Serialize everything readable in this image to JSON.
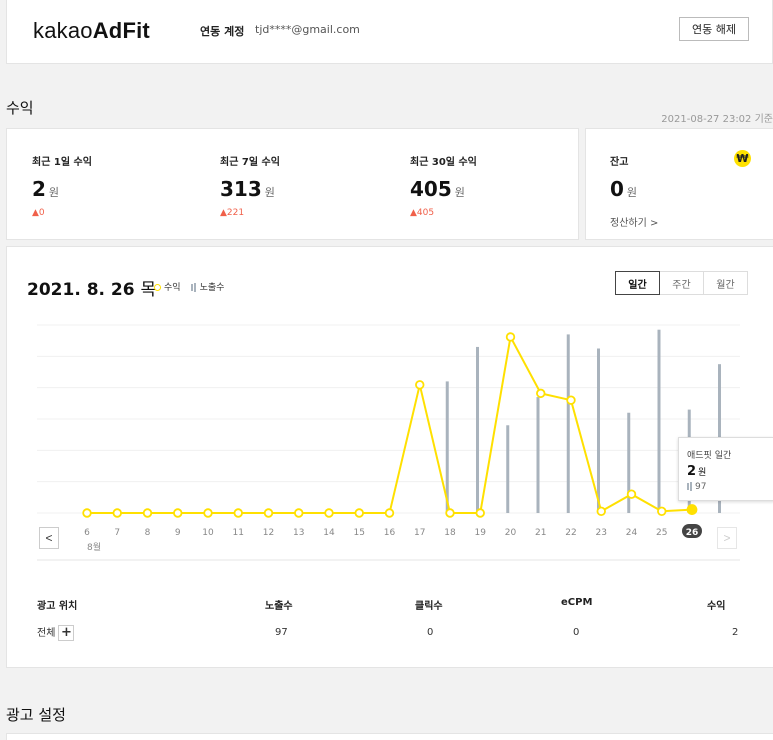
{
  "header": {
    "logo_kakao": "kakao",
    "logo_adfit": "AdFit",
    "account_label": "연동 계정",
    "account_email": "tjd****@gmail.com",
    "unlink_button": "연동 해제"
  },
  "revenue_section": {
    "title": "수익",
    "timestamp": "2021-08-27 23:02 기준"
  },
  "stats": [
    {
      "label": "최근 1일 수익",
      "value": "2",
      "unit": "원",
      "change": "▲0"
    },
    {
      "label": "최근 7일 수익",
      "value": "313",
      "unit": "원",
      "change": "▲221"
    },
    {
      "label": "최근 30일 수익",
      "value": "405",
      "unit": "원",
      "change": "▲405"
    }
  ],
  "balance": {
    "label": "잔고",
    "value": "0",
    "unit": "원",
    "settle_link": "정산하기 >",
    "icon": "won-icon",
    "icon_glyph": "₩"
  },
  "chart": {
    "date": "2021. 8. 26",
    "day_of_week": "목",
    "legend_revenue": "수익",
    "legend_impressions": "노출수",
    "tabs": [
      {
        "label": "일간",
        "active": true
      },
      {
        "label": "주간",
        "active": false
      },
      {
        "label": "월간",
        "active": false
      }
    ],
    "prev_label": "<",
    "next_label": ">",
    "tooltip": {
      "title": "애드핏 일간",
      "value": "2",
      "unit": "원",
      "impressions": "97"
    }
  },
  "chart_data": {
    "type": "bar+line",
    "x": [
      "6",
      "7",
      "8",
      "9",
      "10",
      "11",
      "12",
      "13",
      "14",
      "15",
      "16",
      "17",
      "18",
      "19",
      "20",
      "21",
      "22",
      "23",
      "24",
      "25",
      "26"
    ],
    "x_sub_label": "8월",
    "selected_x": "26",
    "series": [
      {
        "name": "수익",
        "type": "line",
        "values": [
          0,
          0,
          0,
          0,
          0,
          0,
          0,
          0,
          0,
          0,
          0,
          75,
          0,
          0,
          103,
          70,
          66,
          1,
          11,
          1,
          2
        ]
      },
      {
        "name": "노출수",
        "type": "bar",
        "values": [
          0,
          0,
          0,
          0,
          0,
          0,
          0,
          0,
          0,
          0,
          0,
          420,
          530,
          280,
          370,
          570,
          525,
          320,
          585,
          330,
          475
        ]
      }
    ],
    "colors": {
      "line": "#ffe000",
      "bar": "#a9b3bd",
      "selected": "#444444"
    }
  },
  "table": {
    "headers": [
      "광고 위치",
      "노출수",
      "클릭수",
      "eCPM",
      "수익"
    ],
    "row": {
      "position": "전체",
      "impressions": "97",
      "clicks": "0",
      "ecpm": "0",
      "revenue": "2"
    }
  },
  "settings_section": {
    "title": "광고 설정"
  }
}
